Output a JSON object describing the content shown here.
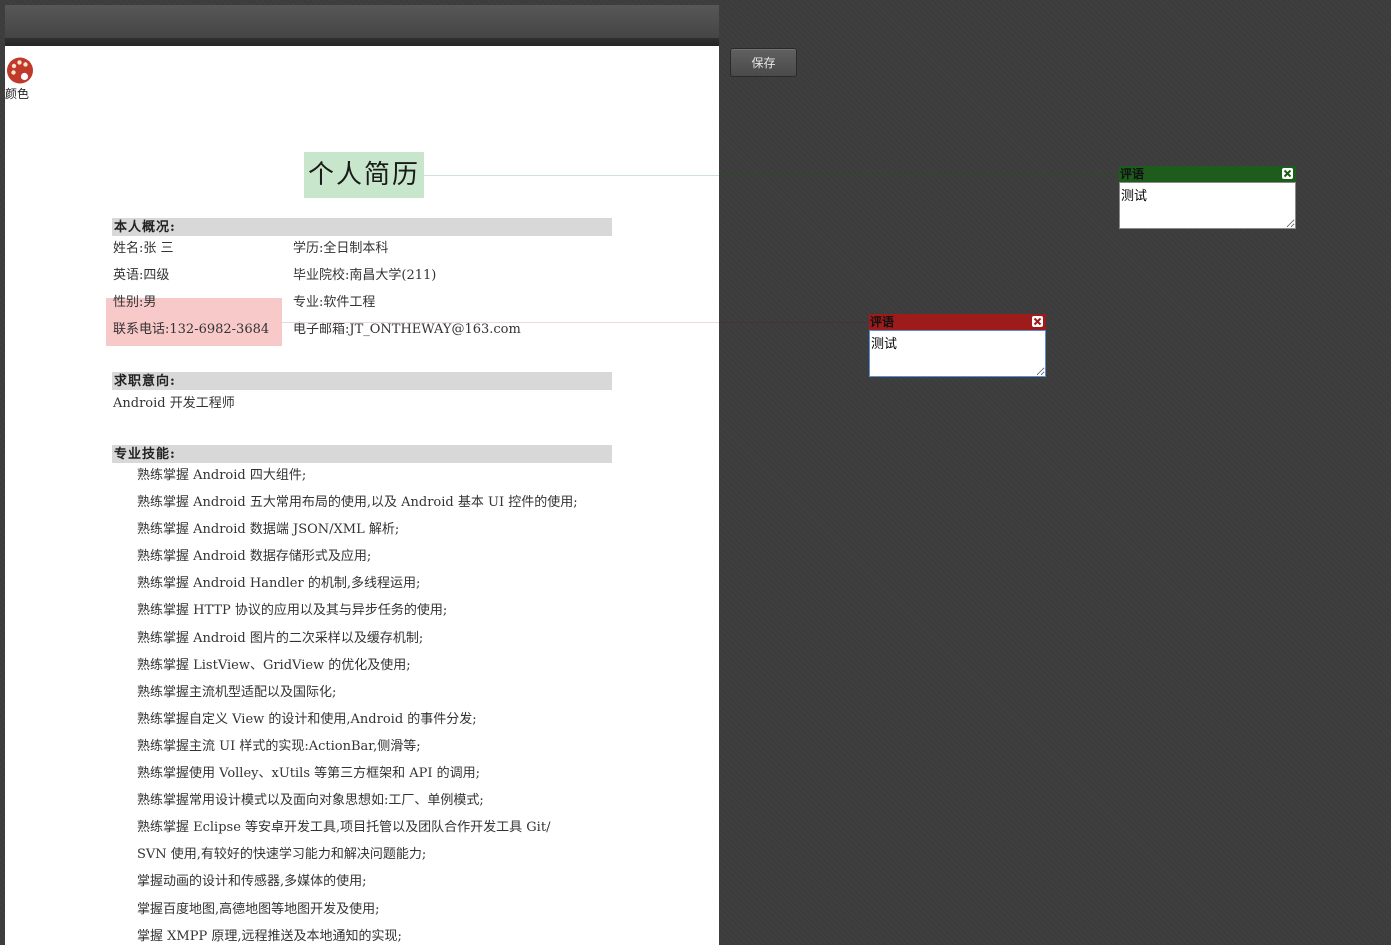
{
  "toolbar": {
    "color_tool_label": "颜色",
    "save_label": "保存"
  },
  "resume": {
    "title": "个人简历",
    "overview": {
      "heading": "本人概况:",
      "name": "姓名:张 三",
      "education": "学历:全日制本科",
      "english": "英语:四级",
      "school": "毕业院校:南昌大学(211)",
      "gender": "性别:男",
      "major": "专业:软件工程",
      "phone": "联系电话:132-6982-3684",
      "email": "电子邮箱:JT_ONTHEWAY@163.com"
    },
    "objective": {
      "heading": "求职意向:",
      "text": "Android 开发工程师"
    },
    "skills": {
      "heading": "专业技能:",
      "items": [
        "熟练掌握 Android 四大组件;",
        "熟练掌握 Android 五大常用布局的使用,以及 Android 基本 UI 控件的使用;",
        "熟练掌握 Android 数据端 JSON/XML 解析;",
        "熟练掌握 Android 数据存储形式及应用;",
        "熟练掌握 Android Handler 的机制,多线程运用;",
        "熟练掌握 HTTP 协议的应用以及其与异步任务的使用;",
        "熟练掌握 Android 图片的二次采样以及缓存机制;",
        "熟练掌握 ListView、GridView 的优化及使用;",
        "熟练掌握主流机型适配以及国际化;",
        "熟练掌握自定义 View 的设计和使用,Android 的事件分发;",
        "熟练掌握主流 UI 样式的实现:ActionBar,侧滑等;",
        "熟练掌握使用 Volley、xUtils 等第三方框架和 API 的调用;",
        "熟练掌握常用设计模式以及面向对象思想如:工厂、单例模式;",
        "熟练掌握 Eclipse 等安卓开发工具,项目托管以及团队合作开发工具 Git/",
        " SVN 使用,有较好的快速学习能力和解决问题能力;",
        "掌握动画的设计和传感器,多媒体的使用;",
        "掌握百度地图,高德地图等地图开发及使用;",
        "掌握 XMPP 原理,远程推送及本地通知的实现;"
      ]
    }
  },
  "comments": [
    {
      "title": "评语",
      "text": "测试",
      "color": "#1e5c1e"
    },
    {
      "title": "评语",
      "text": "测试",
      "color": "#9e1b1b"
    }
  ],
  "colors": {
    "highlight_green": "#c8e6cc",
    "highlight_red": "#f8c9c9",
    "section_gray": "#d8d8d8",
    "background": "#3d3d3d"
  }
}
